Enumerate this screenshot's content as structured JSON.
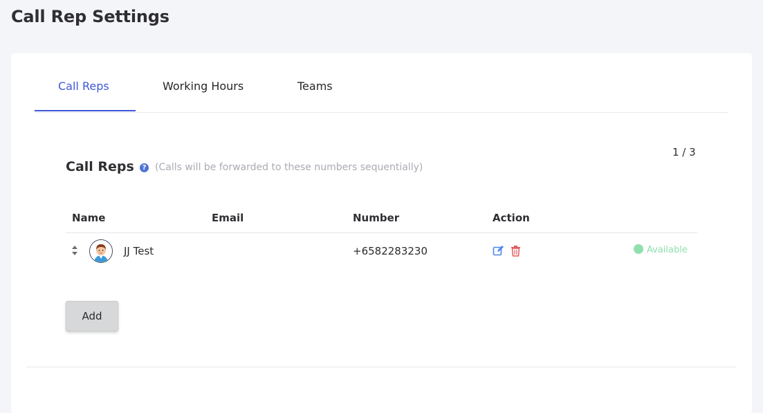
{
  "page": {
    "title": "Call Rep Settings"
  },
  "tabs": [
    {
      "label": "Call Reps",
      "active": true
    },
    {
      "label": "Working Hours",
      "active": false
    },
    {
      "label": "Teams",
      "active": false
    }
  ],
  "section": {
    "title": "Call Reps",
    "help_icon": "question-circle-icon",
    "hint": "(Calls will be forwarded to these numbers sequentially)",
    "pager": "1 / 3"
  },
  "table": {
    "columns": [
      "Name",
      "Email",
      "Number",
      "Action"
    ],
    "rows": [
      {
        "name": "JJ Test",
        "email": "",
        "number": "+6582283230",
        "status": "Available"
      }
    ]
  },
  "actions": {
    "add_label": "Add"
  },
  "colors": {
    "accent": "#3d57d9",
    "edit": "#4a86e8",
    "delete": "#e05d5d",
    "available": "#8fe0ad"
  }
}
